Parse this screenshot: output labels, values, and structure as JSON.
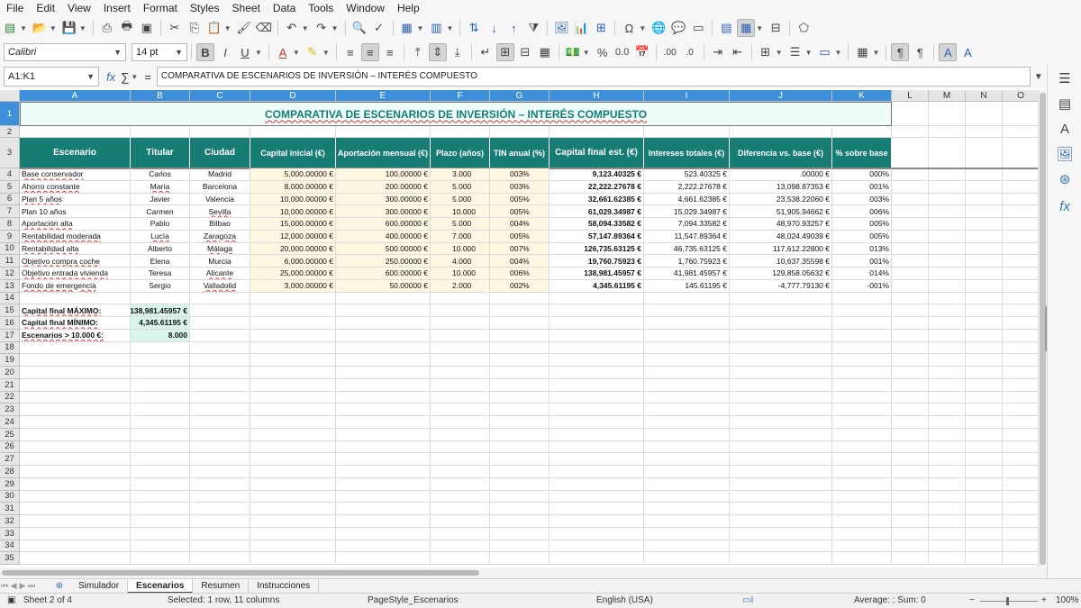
{
  "menu": [
    "File",
    "Edit",
    "View",
    "Insert",
    "Format",
    "Styles",
    "Sheet",
    "Data",
    "Tools",
    "Window",
    "Help"
  ],
  "format_toolbar": {
    "font_name": "Calibri",
    "font_size": "14 pt"
  },
  "formula_bar": {
    "cell_ref": "A1:K1",
    "fx": "fx",
    "sum": "∑",
    "equals": "=",
    "content": "COMPARATIVA DE ESCENARIOS DE INVERSIÓN – INTERÉS COMPUESTO"
  },
  "columns": [
    "A",
    "B",
    "C",
    "D",
    "E",
    "F",
    "G",
    "H",
    "I",
    "J",
    "K",
    "L",
    "M",
    "N",
    "O"
  ],
  "rows": [
    "1",
    "2",
    "3",
    "4",
    "5",
    "6",
    "7",
    "8",
    "9",
    "10",
    "11",
    "12",
    "13",
    "14",
    "15",
    "16",
    "17",
    "18",
    "19",
    "20",
    "21",
    "22",
    "23",
    "24",
    "25",
    "26",
    "27",
    "28",
    "29",
    "30",
    "31",
    "32",
    "33",
    "34",
    "35"
  ],
  "sheet": {
    "title": "COMPARATIVA DE ESCENARIOS DE INVERSIÓN – INTERÉS COMPUESTO",
    "headers": [
      "Escenario",
      "Titular",
      "Ciudad",
      "Capital inicial (€)",
      "Aportación mensual (€)",
      "Plazo (años)",
      "TIN anual (%)",
      "Capital final est. (€)",
      "Intereses totales (€)",
      "Diferencia vs. base (€)",
      "% sobre base"
    ],
    "data": [
      [
        "Base conservador",
        "Carlos",
        "Madrid",
        "5,000.00000 €",
        "100.00000 €",
        "3.000",
        "003%",
        "9,123.40325 €",
        "523.40325 €",
        ".00000 €",
        "000%"
      ],
      [
        "Ahorro constante",
        "María",
        "Barcelona",
        "8,000.00000 €",
        "200.00000 €",
        "5.000",
        "003%",
        "22,222.27678 €",
        "2,222.27678 €",
        "13,098.87353 €",
        "001%"
      ],
      [
        "Plan 5 años",
        "Javier",
        "Valencia",
        "10,000.00000 €",
        "300.00000 €",
        "5.000",
        "005%",
        "32,661.62385 €",
        "4,661.62385 €",
        "23,538.22060 €",
        "003%"
      ],
      [
        "Plan 10 años",
        "Carmen",
        "Sevilla",
        "10,000.00000 €",
        "300.00000 €",
        "10.000",
        "005%",
        "61,029.34987 €",
        "15,029.34987 €",
        "51,905.94662 €",
        "006%"
      ],
      [
        "Aportación alta",
        "Pablo",
        "Bilbao",
        "15,000.00000 €",
        "600.00000 €",
        "5.000",
        "004%",
        "58,094.33582 €",
        "7,094.33582 €",
        "48,970.93257 €",
        "005%"
      ],
      [
        "Rentabilidad moderada",
        "Lucía",
        "Zaragoza",
        "12,000.00000 €",
        "400.00000 €",
        "7.000",
        "005%",
        "57,147.89364 €",
        "11,547.89364 €",
        "48,024.49039 €",
        "005%"
      ],
      [
        "Rentabilidad alta",
        "Alberto",
        "Málaga",
        "20,000.00000 €",
        "500.00000 €",
        "10.000",
        "007%",
        "126,735.63125 €",
        "46,735.63125 €",
        "117,612.22800 €",
        "013%"
      ],
      [
        "Objetivo compra coche",
        "Elena",
        "Murcia",
        "6,000.00000 €",
        "250.00000 €",
        "4.000",
        "004%",
        "19,760.75923 €",
        "1,760.75923 €",
        "10,637.35598 €",
        "001%"
      ],
      [
        "Objetivo entrada vivienda",
        "Teresa",
        "Alicante",
        "25,000.00000 €",
        "600.00000 €",
        "10.000",
        "006%",
        "138,981.45957 €",
        "41,981.45957 €",
        "129,858.05632 €",
        "014%"
      ],
      [
        "Fondo de emergencia",
        "Sergio",
        "Valladolid",
        "3,000.00000 €",
        "50.00000 €",
        "2.000",
        "002%",
        "4,345.61195 €",
        "145.61195 €",
        "-4,777.79130 €",
        "-001%"
      ]
    ],
    "summary": [
      {
        "label": "Capital final MÁXIMO:",
        "value": "138,981.45957 €"
      },
      {
        "label": "Capital final MÍNIMO:",
        "value": "4,345.61195 €"
      },
      {
        "label": "Escenarios > 10.000 €:",
        "value": "8.000"
      }
    ]
  },
  "tabs": [
    "Simulador",
    "Escenarios",
    "Resumen",
    "Instrucciones"
  ],
  "active_tab": "Escenarios",
  "status": {
    "sheet": "Sheet 2 of 4",
    "selection": "Selected: 1 row, 11 columns",
    "page_style": "PageStyle_Escenarios",
    "language": "English (USA)",
    "sum": "Average: ; Sum: 0",
    "zoom": "100%"
  },
  "colors": {
    "header_bg": "#177d74",
    "title_bg": "#eefcfa",
    "input_bg": "#fdf6e0",
    "summary_bg": "#d9f5ea",
    "selection": "#3d8fd9"
  }
}
